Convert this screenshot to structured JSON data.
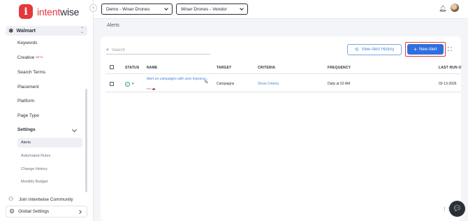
{
  "brand": {
    "logo_letter": "i",
    "name_prefix": "intent",
    "name_suffix": "wise"
  },
  "account": {
    "label": "Walmart",
    "icon": "network-icon"
  },
  "sidebar": {
    "items": [
      {
        "label": "Keywords"
      },
      {
        "label": "Creative",
        "badge": "BETA"
      },
      {
        "label": "Search Terms"
      },
      {
        "label": "Placement"
      },
      {
        "label": "Platform"
      },
      {
        "label": "Page Type"
      }
    ],
    "settings": {
      "label": "Settings",
      "children": [
        {
          "label": "Alerts",
          "active": true
        },
        {
          "label": "Automated Rules"
        },
        {
          "label": "Change History"
        },
        {
          "label": "Monthly Budget"
        }
      ]
    },
    "community": "Join Intentwise Community",
    "global_settings": "Global Settings"
  },
  "topbar": {
    "dropdown_demo": "Demo - Wiser Drones",
    "dropdown_vendor": "Wiser Drones - Vendor",
    "collapse_glyph": "‹"
  },
  "page": {
    "title": "Alerts"
  },
  "toolbar": {
    "search_placeholder": "Search",
    "view_history": "View Alert History",
    "new_alert": "New Alert"
  },
  "table": {
    "columns": [
      "STATUS",
      "NAME",
      "TARGET",
      "CRITERIA",
      "FREQUENCY",
      "LAST RUN O"
    ],
    "rows": [
      {
        "name": "Alert on campaigns with zero Impressi...",
        "meta": "ees 🚗",
        "target": "Campaigns",
        "criteria": "Show Criteria",
        "frequency": "Daily at 02 AM",
        "last_run": "02-13-2026"
      }
    ]
  },
  "colors": {
    "brand": "#e5383b",
    "primary": "#2f6fe0",
    "link": "#4a86d6",
    "highlight": "#e53935",
    "status_ok": "#3da86b"
  }
}
